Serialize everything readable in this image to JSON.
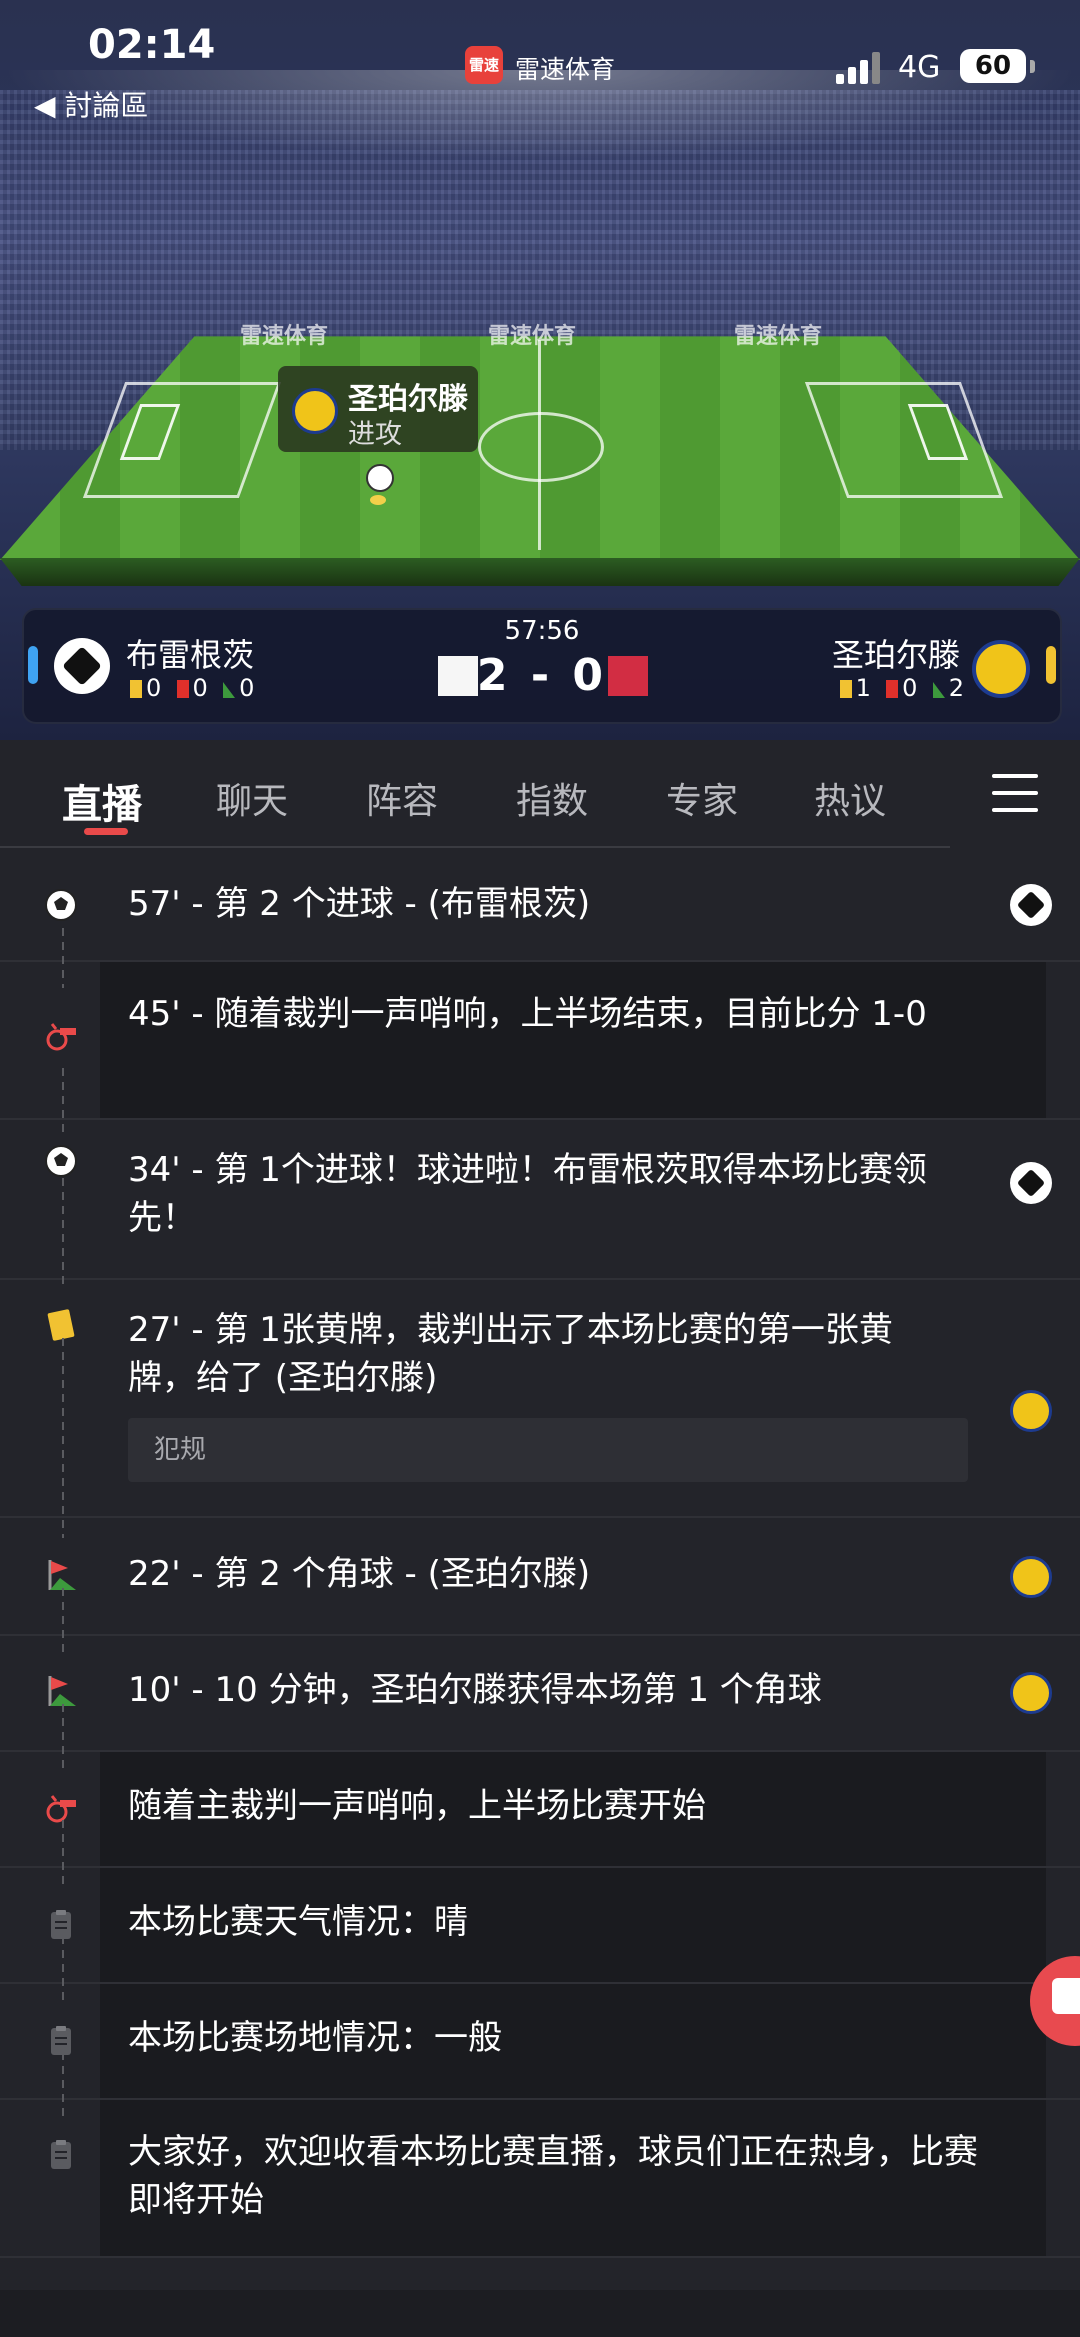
{
  "status_bar": {
    "time": "02:14",
    "back_label": "◀ 討論區",
    "app_name": "雷速体育",
    "app_badge": "雷速",
    "network": "4G",
    "battery": "60"
  },
  "pitch": {
    "ad_text": "雷速体育",
    "tooltip": {
      "team": "圣珀尔滕",
      "action": "进攻"
    }
  },
  "scoreboard": {
    "match_time": "57:56",
    "score": "2 - 0",
    "home": {
      "name": "布雷根茨",
      "yellow": "0",
      "red": "0",
      "corners": "0"
    },
    "away": {
      "name": "圣珀尔滕",
      "yellow": "1",
      "red": "0",
      "corners": "2"
    }
  },
  "tabs": [
    {
      "label": "直播",
      "active": true
    },
    {
      "label": "聊天"
    },
    {
      "label": "阵容"
    },
    {
      "label": "指数"
    },
    {
      "label": "专家"
    },
    {
      "label": "热议"
    }
  ],
  "events": [
    {
      "icon": "soccer-ball-icon",
      "text": "57' - 第 2 个进球 - (布雷根茨)",
      "team": "home"
    },
    {
      "icon": "whistle-icon",
      "text": "45' - 随着裁判一声哨响，上半场结束，目前比分 1-0",
      "boxed": true
    },
    {
      "icon": "soccer-ball-icon",
      "text": "34' - 第 1个进球！球进啦！布雷根茨取得本场比赛领先！",
      "team": "home"
    },
    {
      "icon": "yellow-card-icon",
      "text": "27' - 第 1张黄牌，裁判出示了本场比赛的第一张黄牌，给了 (圣珀尔滕)",
      "team": "away",
      "note": "犯规"
    },
    {
      "icon": "corner-flag-icon",
      "text": "22' - 第 2 个角球 - (圣珀尔滕)",
      "team": "away"
    },
    {
      "icon": "corner-flag-icon",
      "text": "10' - 10 分钟，圣珀尔滕获得本场第 1 个角球",
      "team": "away"
    },
    {
      "icon": "whistle-icon",
      "text": "随着主裁判一声哨响，上半场比赛开始",
      "boxed": true
    },
    {
      "icon": "clipboard-icon",
      "text": "本场比赛天气情况：晴",
      "boxed": true
    },
    {
      "icon": "clipboard-icon",
      "text": "本场比赛场地情况：一般",
      "boxed": true
    },
    {
      "icon": "clipboard-icon",
      "text": "大家好，欢迎收看本场比赛直播，球员们正在热身，比赛即将开始",
      "boxed": true
    }
  ],
  "colors": {
    "accent_red": "#e94a4a",
    "yellow_card": "#f1c232",
    "home_bar": "#3fa3f2",
    "background": "#23242a"
  }
}
